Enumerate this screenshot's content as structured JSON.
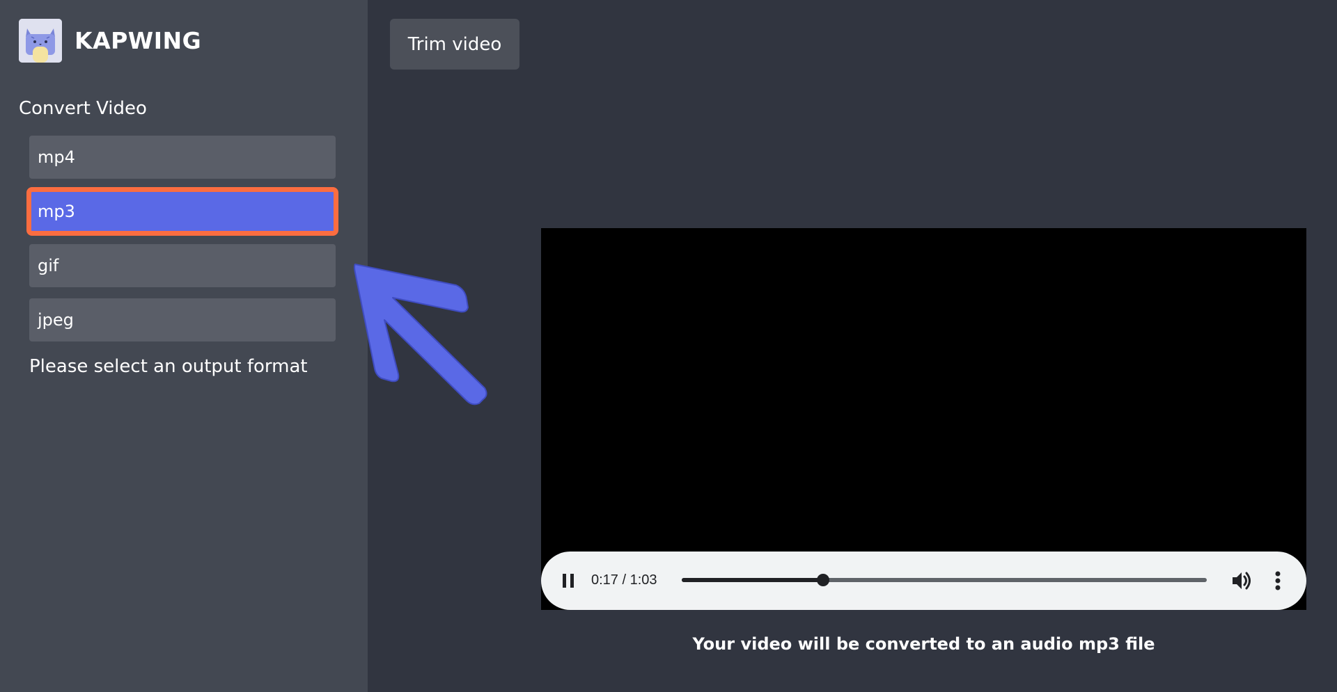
{
  "brand": {
    "name": "KAPWING",
    "logo_icon": "cat-logo-icon"
  },
  "sidebar": {
    "section_title": "Convert Video",
    "formats": [
      {
        "label": "mp4",
        "selected": false
      },
      {
        "label": "mp3",
        "selected": true
      },
      {
        "label": "gif",
        "selected": false
      },
      {
        "label": "jpeg",
        "selected": false
      }
    ],
    "hint": "Please select an output format"
  },
  "toolbar": {
    "trim_label": "Trim video"
  },
  "player": {
    "time_display": "0:17 / 1:03",
    "current_seconds": 17,
    "duration_seconds": 63,
    "state": "playing"
  },
  "caption": "Your video will be converted to an audio mp3 file",
  "colors": {
    "page_bg": "#313540",
    "sidebar_bg": "#434852",
    "item_bg": "#5a5e68",
    "selected_bg": "#5a69e6",
    "highlight_border": "#fb6d40",
    "arrow": "#5a69e6"
  }
}
